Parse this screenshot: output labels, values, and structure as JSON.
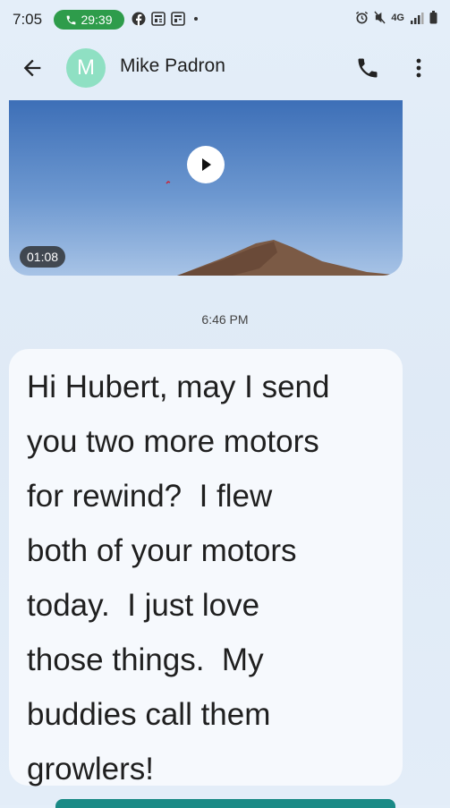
{
  "status_bar": {
    "time": "7:05",
    "call_timer": "29:39",
    "network": "4G",
    "icons": [
      "facebook-icon",
      "news-icon",
      "news-icon",
      "alarm-icon",
      "mute-icon",
      "signal-icon",
      "battery-icon"
    ]
  },
  "header": {
    "avatar_initial": "M",
    "contact_name": "Mike Padron",
    "avatar_color": "#8fe0c3"
  },
  "video": {
    "duration": "01:08"
  },
  "messages": [
    {
      "timestamp": "6:46 PM",
      "text": "Hi Hubert, may I send\nyou two more motors\nfor rewind?  I flew\nboth of your motors\ntoday.  I just love\nthose things.  My\nbuddies call them\ngrowlers!"
    }
  ],
  "colors": {
    "call_pill": "#2e9c4b",
    "background": "#e4eef9",
    "bubble": "#f6f9fd"
  }
}
